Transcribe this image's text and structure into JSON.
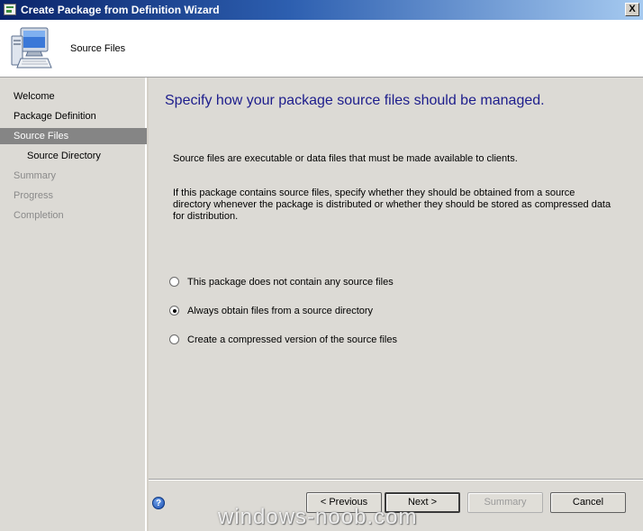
{
  "window": {
    "title": "Create Package from Definition Wizard",
    "close_label": "X"
  },
  "header": {
    "title": "Source Files",
    "icon": "computer-icon"
  },
  "nav": {
    "items": [
      {
        "label": "Welcome",
        "state": "normal"
      },
      {
        "label": "Package Definition",
        "state": "normal"
      },
      {
        "label": "Source Files",
        "state": "selected"
      },
      {
        "label": "Source Directory",
        "state": "sub"
      },
      {
        "label": "Summary",
        "state": "disabled"
      },
      {
        "label": "Progress",
        "state": "disabled"
      },
      {
        "label": "Completion",
        "state": "disabled"
      }
    ]
  },
  "main": {
    "title": "Specify how your package source files should be managed.",
    "para1": "Source files are executable or data files that must be made available to clients.",
    "para2": "If this package contains source files, specify whether they should be obtained from a source directory whenever the package is distributed or whether they should be stored as compressed data for distribution.",
    "options": [
      {
        "label": "This package does not contain any source files",
        "checked": false
      },
      {
        "label": "Always obtain files from a source directory",
        "checked": true
      },
      {
        "label": "Create a compressed version of the source files",
        "checked": false
      }
    ]
  },
  "footer": {
    "help_symbol": "?",
    "previous_label": "< Previous",
    "next_label": "Next >",
    "summary_label": "Summary",
    "cancel_label": "Cancel"
  },
  "watermark": "windows-noob.com",
  "colors": {
    "title_bar": "#0a246a",
    "heading": "#1d1d8c",
    "nav_selected": "#858585",
    "background": "#dcdad5"
  }
}
